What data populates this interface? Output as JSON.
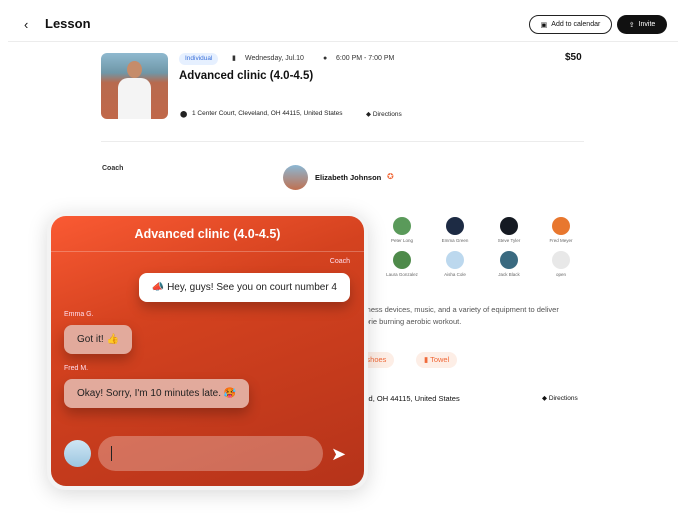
{
  "header": {
    "title": "Lesson",
    "add_to_calendar": "Add to calendar",
    "invite": "Invite"
  },
  "lesson": {
    "type_badge": "Individual",
    "date": "Wednesday, Jul.10",
    "time": "6:00 PM - 7:00 PM",
    "title": "Advanced clinic (4.0-4.5)",
    "price": "$50",
    "address": "1 Center Court, Cleveland, OH 44115, United States",
    "directions": "Directions"
  },
  "coach": {
    "label": "Coach",
    "name": "Elizabeth Johnson"
  },
  "participants": [
    {
      "name": "Peter Long",
      "color": "#5a9a5a"
    },
    {
      "name": "Emma Green",
      "color": "#1d2b44"
    },
    {
      "name": "Steve Tyler",
      "color": "#151a22"
    },
    {
      "name": "Fred Meyer",
      "color": "#e8772e"
    },
    {
      "name": "Laura Gonzalez",
      "color": "#4e8a4a"
    },
    {
      "name": "Aisha Cole",
      "color": "#bcd8ee"
    },
    {
      "name": "Jack Black",
      "color": "#3a6a80"
    },
    {
      "name": "open",
      "color": "#e8e8e8"
    }
  ],
  "description": {
    "line1": "s fitness devices, music, and a variety of equipment to deliver",
    "line2": "calorie burning aerobic workout."
  },
  "equipment": [
    "Court shoes",
    "Towel"
  ],
  "location": {
    "address": "1 Center Court, Cleveland, OH 44115, United States",
    "directions": "Directions"
  },
  "chat": {
    "title": "Advanced clinic (4.0-4.5)",
    "messages": [
      {
        "sender": "Coach",
        "text": "📣 Hey, guys! See you on court number 4"
      },
      {
        "sender": "Emma G.",
        "text": "Got it! 👍"
      },
      {
        "sender": "Fred M.",
        "text": "Okay! Sorry, I'm 10 minutes late. 🥵"
      }
    ],
    "input_value": ""
  },
  "colors": {
    "accent": "#f05a33",
    "badge_bg": "#e6f0ff",
    "badge_text": "#3a6fd8"
  }
}
